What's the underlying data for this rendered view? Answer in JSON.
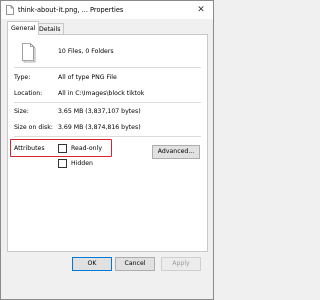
{
  "window": {
    "title": "think-about-it.png, ... Properties",
    "close_glyph": "✕"
  },
  "tabs": [
    {
      "label": "General",
      "active": true
    },
    {
      "label": "Details",
      "active": false
    }
  ],
  "summary": {
    "file_count": "10 Files, 0 Folders"
  },
  "properties": [
    {
      "label": "Type:",
      "value": "All of type PNG File"
    },
    {
      "label": "Location:",
      "value": "All in C:\\Images\\block tiktok"
    },
    {
      "label": "Size:",
      "value": "3.65 MB (3,837,107 bytes)"
    },
    {
      "label": "Size on disk:",
      "value": "3.69 MB (3,874,816 bytes)"
    }
  ],
  "attributes": {
    "label": "Attributes",
    "read_only_label": "Read-only",
    "read_only_checked": false,
    "hidden_label": "Hidden",
    "hidden_checked": false,
    "advanced_label": "Advanced..."
  },
  "highlight_color": "#d9232e",
  "buttons": {
    "ok": "OK",
    "cancel": "Cancel",
    "apply": "Apply"
  }
}
